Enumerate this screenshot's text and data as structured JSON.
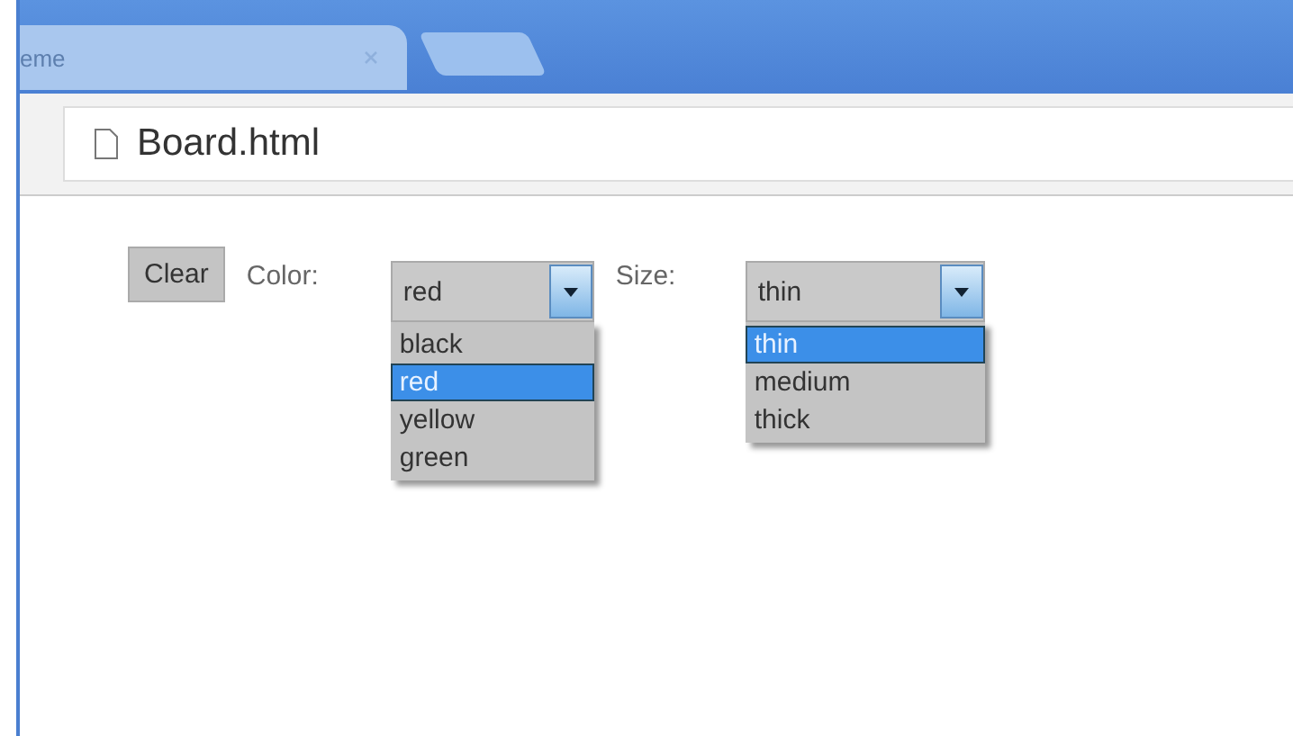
{
  "browser": {
    "tab_title": "eme",
    "address": "Board.html"
  },
  "toolbar": {
    "clear_button": "Clear",
    "selects": [
      {
        "label": "Color:",
        "value": "red",
        "open": true,
        "options": [
          {
            "label": "black",
            "selected": false
          },
          {
            "label": "red",
            "selected": true
          },
          {
            "label": "yellow",
            "selected": false
          },
          {
            "label": "green",
            "selected": false
          }
        ]
      },
      {
        "label": "Size:",
        "value": "thin",
        "open": true,
        "options": [
          {
            "label": "thin",
            "selected": true
          },
          {
            "label": "medium",
            "selected": false
          },
          {
            "label": "thick",
            "selected": false
          }
        ]
      }
    ]
  }
}
